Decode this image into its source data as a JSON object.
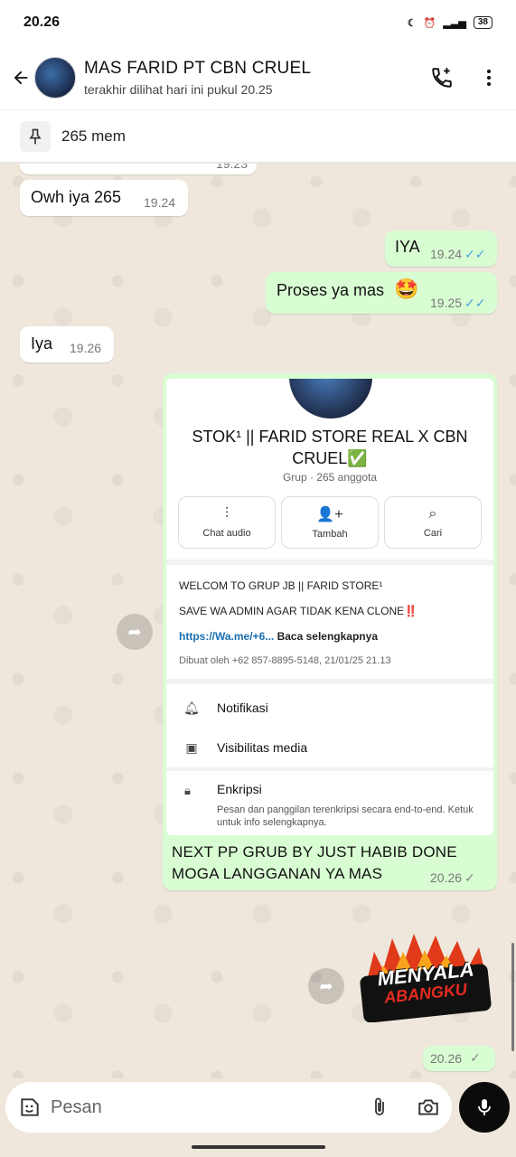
{
  "status": {
    "time": "20.26",
    "battery": "38"
  },
  "header": {
    "title": "MAS FARID PT CBN CRUEL",
    "subtitle": "terakhir dilihat hari ini pukul 20.25"
  },
  "pinned": {
    "text": "265 mem"
  },
  "messages": [
    {
      "text": "Owh iya 265",
      "time": "19.24"
    },
    {
      "text": "IYA",
      "time": "19.24"
    },
    {
      "text": "Proses ya mas",
      "time": "19.25"
    },
    {
      "text": "Iya",
      "time": "19.26"
    },
    {
      "text": "NEXT PP GRUB BY JUST HABIB DONE MOGA LANGGANAN YA MAS",
      "time": "20.26"
    },
    {
      "time": "20.26"
    }
  ],
  "partial_time": "19.23",
  "group_card": {
    "title": "STOK¹ || FARID STORE REAL X CBN CRUEL✅",
    "subtitle": "Grup · 265 anggota",
    "actions": [
      "Chat audio",
      "Tambah",
      "Cari"
    ],
    "desc_line1": "WELCOM TO GRUP JB || FARID STORE¹",
    "desc_line2": "SAVE WA ADMIN AGAR TIDAK KENA CLONE‼️",
    "desc_link": "https://Wa.me/+6...",
    "desc_more": "Baca selengkapnya",
    "desc_meta": "Dibuat oleh +62 857-8895-5148, 21/01/25 21.13",
    "settings": [
      "Notifikasi",
      "Visibilitas media"
    ],
    "encryption_title": "Enkripsi",
    "encryption_text": "Pesan dan panggilan terenkripsi secara end-to-end. Ketuk untuk info selengkapnya."
  },
  "sticker": {
    "line1": "MENYALA",
    "line2": "ABANGKU"
  },
  "input": {
    "placeholder": "Pesan"
  }
}
